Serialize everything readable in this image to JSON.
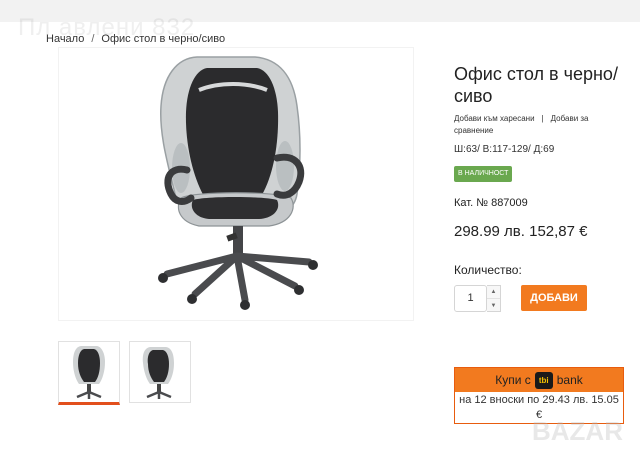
{
  "watermark_top": "Пл    авлени   832",
  "breadcrumb": {
    "home": "Начало",
    "separator": "/",
    "current": "Офис стол в черно/сиво"
  },
  "product": {
    "title": "Офис стол в черно/ сиво",
    "add_to_favorites": "Добави към харесани",
    "actions_separator": "|",
    "add_to_compare": "Добави за сравнение",
    "dimensions": "Ш:63/ В:117-129/ Д:69",
    "stock_status": "В НАЛИЧНОСТ",
    "catalog_number": "Кат. № 887009",
    "price": "298.99 лв. 152,87 €"
  },
  "cart": {
    "quantity_label": "Количество:",
    "quantity_value": "1",
    "add_button": "ДОБАВИ"
  },
  "tbi": {
    "prefix": "Купи с",
    "logo_text": "tbi",
    "suffix": "bank",
    "installments": "на 12 вноски по 29.43 лв. 15.05 €"
  },
  "colors": {
    "accent": "#f27a1f",
    "stock_green": "#6aa84f",
    "tbi_border": "#e85c0e"
  },
  "thumbnails": [
    "thumb-1",
    "thumb-2"
  ],
  "watermark_br": "BAZAR"
}
